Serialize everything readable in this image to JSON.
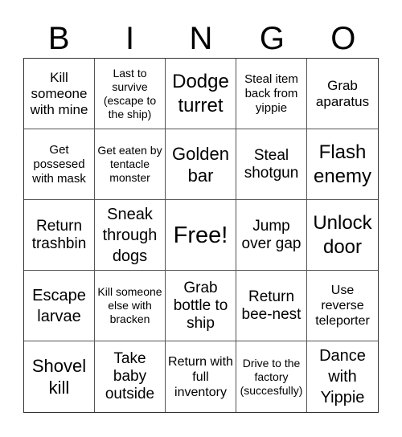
{
  "header": {
    "letters": [
      "B",
      "I",
      "N",
      "G",
      "O"
    ]
  },
  "cells": [
    "Kill someone with mine",
    "Last to survive (escape to the ship)",
    "Dodge turret",
    "Steal item back from yippie",
    "Grab aparatus",
    "Get possesed with mask",
    "Get eaten by tentacle monster",
    "Golden bar",
    "Steal shotgun",
    "Flash enemy",
    "Return trashbin",
    "Sneak through dogs",
    "Free!",
    "Jump over gap",
    "Unlock door",
    "Escape larvae",
    "Kill someone else with bracken",
    "Grab bottle to ship",
    "Return bee-nest",
    "Use reverse teleporter",
    "Shovel kill",
    "Take baby outside",
    "Return with full inventory",
    "Drive to the factory (succesfully)",
    "Dance with Yippie"
  ]
}
